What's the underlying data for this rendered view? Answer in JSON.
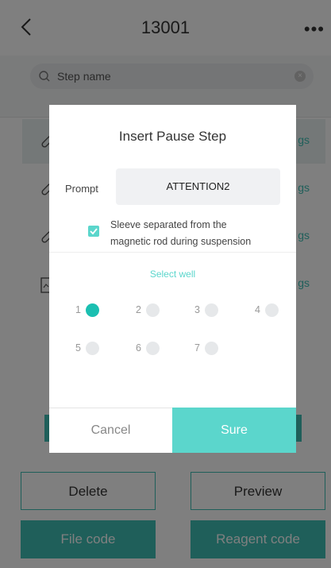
{
  "header": {
    "title": "13001",
    "more": "•••"
  },
  "search": {
    "placeholder": "Step name"
  },
  "steps": [
    {
      "suffix": "gs"
    },
    {
      "suffix": "gs"
    },
    {
      "suffix": "gs"
    },
    {
      "suffix": "gs"
    }
  ],
  "bottom": {
    "delete_label": "Delete",
    "preview_label": "Preview",
    "file_code_label": "File code",
    "reagent_code_label": "Reagent code"
  },
  "dialog": {
    "title": "Insert Pause Step",
    "prompt_label": "Prompt",
    "prompt_value": "ATTENTION2",
    "checkbox_checked": true,
    "checkbox_text_line1": "Sleeve separated from the",
    "checkbox_text_line2": "magnetic rod during suspension",
    "select_well_title": "Select well",
    "wells": [
      {
        "num": "1",
        "selected": true
      },
      {
        "num": "2",
        "selected": false
      },
      {
        "num": "3",
        "selected": false
      },
      {
        "num": "4",
        "selected": false
      },
      {
        "num": "5",
        "selected": false
      },
      {
        "num": "6",
        "selected": false
      },
      {
        "num": "7",
        "selected": false
      }
    ],
    "cancel_label": "Cancel",
    "sure_label": "Sure"
  },
  "colors": {
    "accent": "#3fbfb5",
    "accent_light": "#5bd6cc",
    "selected_well": "#1bbfb1"
  }
}
